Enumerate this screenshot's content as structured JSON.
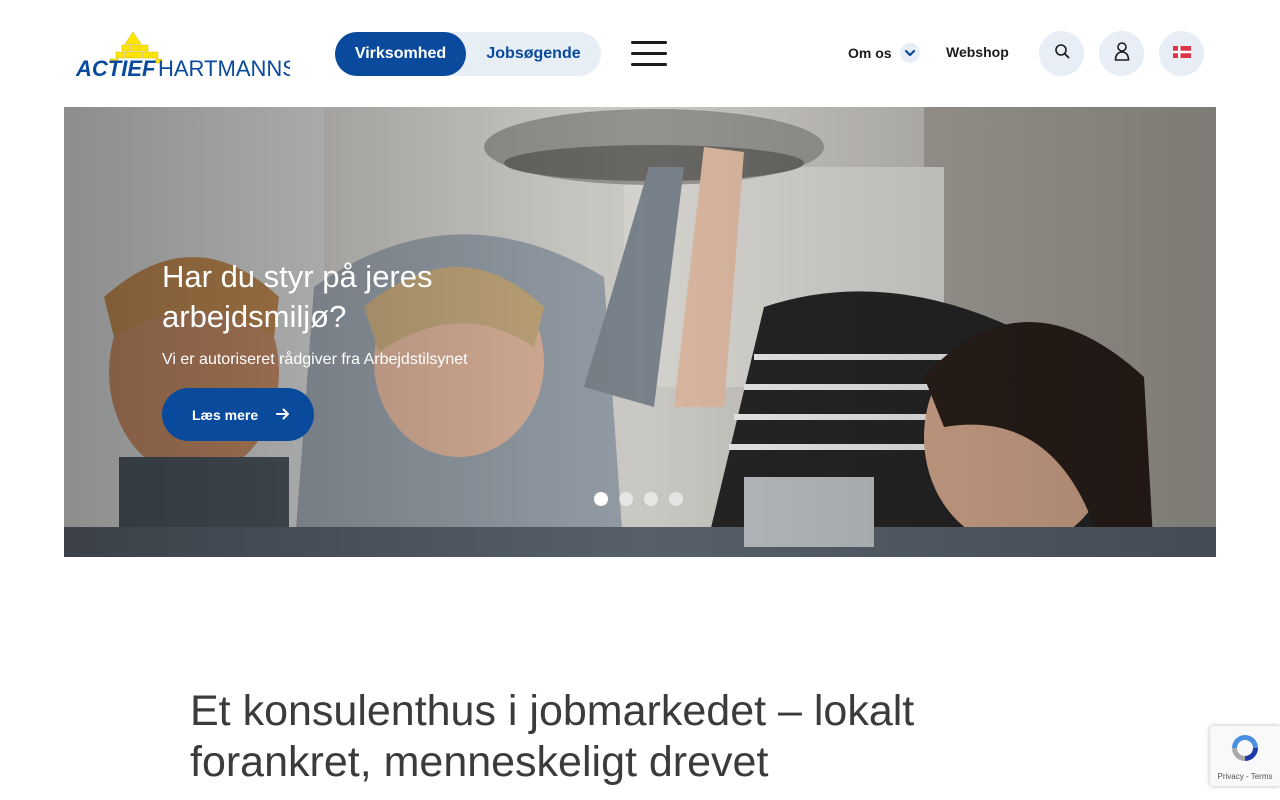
{
  "header": {
    "logo_text": "ACTIEF HARTMANNS",
    "segments": {
      "active": "Virksomhed",
      "inactive": "Jobsøgende"
    },
    "nav": {
      "omos": "Om os",
      "webshop": "Webshop"
    },
    "icons": {
      "menu": "hamburger-menu-icon",
      "search": "search-icon",
      "user": "user-icon",
      "language": "danish-flag-icon",
      "chevron": "chevron-down-icon"
    }
  },
  "hero": {
    "title": "Har du styr på jeres arbejdsmiljø?",
    "subtitle": "Vi er autoriseret rådgiver fra Arbejdstilsynet",
    "cta_label": "Læs mere",
    "slides_total": 4,
    "active_slide": 1
  },
  "intro": {
    "heading": "Et konsulenthus i jobmarkedet – lokalt forankret, menneskeligt drevet"
  },
  "recaptcha": {
    "text": "Privacy - Terms"
  },
  "colors": {
    "brand_blue": "#0a4a9c",
    "logo_yellow": "#ffe600",
    "chip_bg": "#e8eef6"
  }
}
